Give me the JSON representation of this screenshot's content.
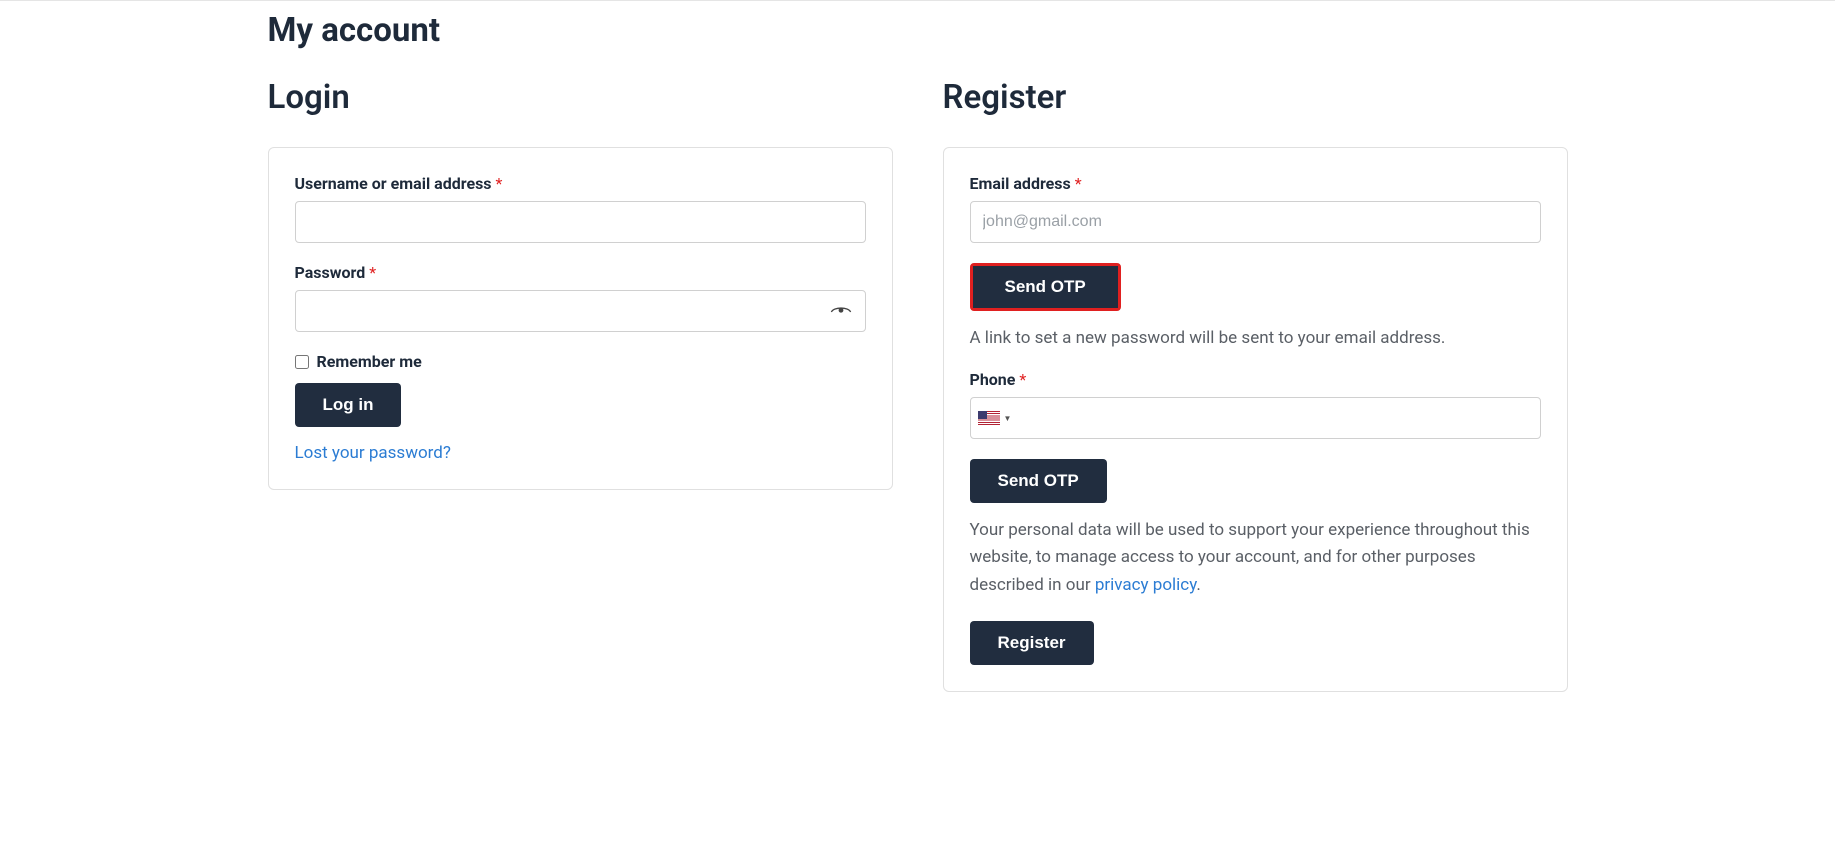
{
  "page": {
    "title": "My account"
  },
  "login": {
    "title": "Login",
    "username_label": "Username or email address",
    "password_label": "Password",
    "remember_label": "Remember me",
    "login_button": "Log in",
    "lost_password": "Lost your password?",
    "asterisk": "*"
  },
  "register": {
    "title": "Register",
    "email_label": "Email address",
    "email_placeholder": "john@gmail.com",
    "send_otp_email": "Send OTP",
    "email_help": "A link to set a new password will be sent to your email address.",
    "phone_label": "Phone",
    "send_otp_phone": "Send OTP",
    "privacy_text_pre": "Your personal data will be used to support your experience throughout this website, to manage access to your account, and for other purposes described in our ",
    "privacy_link": "privacy policy",
    "privacy_text_post": ".",
    "register_button": "Register",
    "asterisk": "*"
  }
}
